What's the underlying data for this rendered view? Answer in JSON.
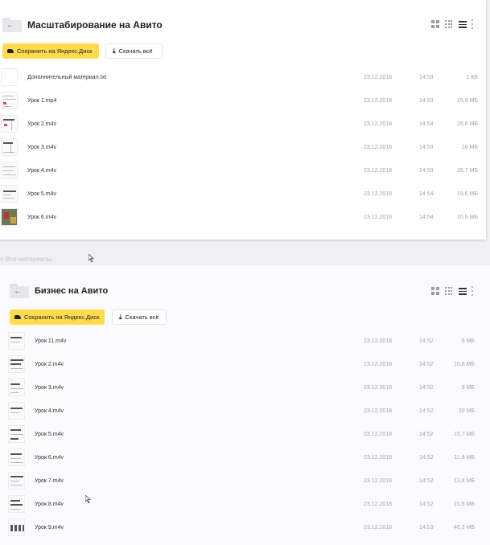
{
  "panel1": {
    "title": "Масштабирование на Авито",
    "save_label": "Сохранить на Яндекс.Диск",
    "download_label": "Скачать всё",
    "files": [
      {
        "name": "Дополнительный материал.txt",
        "date": "23.12.2018",
        "time": "14:53",
        "size": "1 КБ"
      },
      {
        "name": "Урок 1.mp4",
        "date": "23.12.2018",
        "time": "14:53",
        "size": "15,9 МБ"
      },
      {
        "name": "Урок 2.m4v",
        "date": "23.12.2018",
        "time": "14:54",
        "size": "28,8 МБ"
      },
      {
        "name": "Урок 3.m4v",
        "date": "23.12.2018",
        "time": "14:53",
        "size": "26 МБ"
      },
      {
        "name": "Урок 4.m4v",
        "date": "23.12.2018",
        "time": "14:53",
        "size": "26,7 МБ"
      },
      {
        "name": "Урок 5.m4v",
        "date": "23.12.2018",
        "time": "14:54",
        "size": "19,6 МБ"
      },
      {
        "name": "Урок 6.m4v",
        "date": "23.12.2018",
        "time": "14:54",
        "size": "20,9 МБ"
      }
    ]
  },
  "gap_note": "< Все материалы",
  "panel2": {
    "title": "Бизнес на Авито",
    "save_label": "Сохранить на Яндекс.Диск",
    "download_label": "Скачать всё",
    "files": [
      {
        "name": "Урок 11.m4v",
        "date": "23.12.2018",
        "time": "14:52",
        "size": "6 МБ"
      },
      {
        "name": "Урок 2.m4v",
        "date": "23.12.2018",
        "time": "14:52",
        "size": "10,8 МБ"
      },
      {
        "name": "Урок 3.m4v",
        "date": "23.12.2018",
        "time": "14:52",
        "size": "9 МБ"
      },
      {
        "name": "Урок 4.m4v",
        "date": "23.12.2018",
        "time": "14:52",
        "size": "20 МБ"
      },
      {
        "name": "Урок 5.m4v",
        "date": "23.12.2018",
        "time": "14:52",
        "size": "15,7 МБ"
      },
      {
        "name": "Урок 6.m4v",
        "date": "23.12.2018",
        "time": "14:52",
        "size": "11,8 МБ"
      },
      {
        "name": "Урок 7.m4v",
        "date": "23.12.2018",
        "time": "14:52",
        "size": "13,4 МБ"
      },
      {
        "name": "Урок 8.m4v",
        "date": "23.12.2018",
        "time": "14:52",
        "size": "15,6 МБ"
      },
      {
        "name": "Урок 9.m4v",
        "date": "23.12.2018",
        "time": "14:53",
        "size": "46,2 МБ"
      }
    ]
  },
  "icons": {
    "back": "arrow-left-icon",
    "folder": "folder-icon",
    "view_large": "large-tiles-icon",
    "view_small": "small-tiles-icon",
    "view_list": "list-view-icon",
    "more": "more-dots-icon",
    "download": "download-icon",
    "disk": "yandex-disk-icon"
  },
  "colors": {
    "save_button": "#ffdb4d",
    "date_text": "#a3a3a8",
    "background": "#f0f0f2"
  }
}
